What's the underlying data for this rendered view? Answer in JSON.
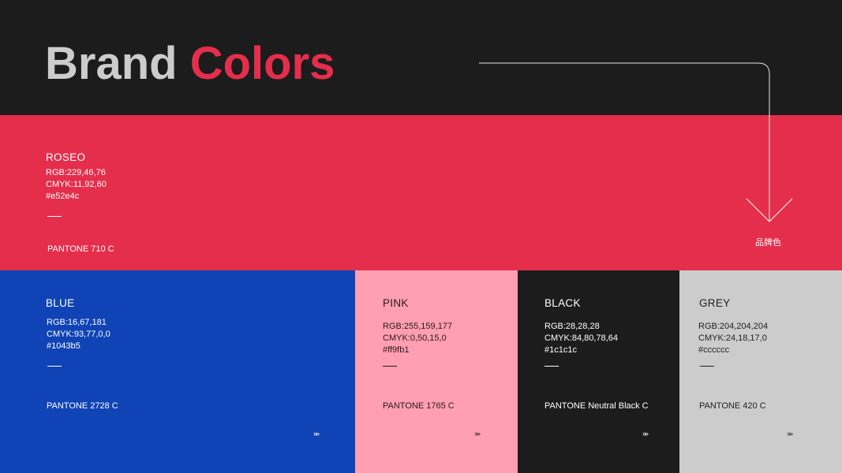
{
  "header": {
    "title_word1": "Brand",
    "title_word2": "Colors"
  },
  "primary": {
    "name": "ROSEO",
    "rgb": "RGB:229,46,76",
    "cmyk": "CMYK:11,92,60",
    "hex": "#e52e4c",
    "pantone": "PANTONE 710 C",
    "label": "品牌色",
    "bg": "#e52e4c",
    "text": "#ffffff"
  },
  "swatches": [
    {
      "name": "BLUE",
      "rgb": "RGB:16,67,181",
      "cmyk": "CMYK:93,77,0,0",
      "hex": "#1043b5",
      "pantone": "PANTONE 2728 C",
      "more": "»»",
      "bg": "#1043b5",
      "text": "#ffffff"
    },
    {
      "name": "PINK",
      "rgb": "RGB:255,159,177",
      "cmyk": "CMYK:0,50,15,0",
      "hex": "#ff9fb1",
      "pantone": "PANTONE 1765 C",
      "more": "»»",
      "bg": "#ff9fb1",
      "text": "#2a1a1d"
    },
    {
      "name": "BLACK",
      "rgb": "RGB:28,28,28",
      "cmyk": "CMYK:84,80,78,64",
      "hex": "#1c1c1c",
      "pantone": "PANTONE Neutral Black C",
      "more": "»»",
      "bg": "#1c1c1c",
      "text": "#ffffff"
    },
    {
      "name": "GREY",
      "rgb": "RGB:204,204,204",
      "cmyk": "CMYK:24,18,17,0",
      "hex": "#cccccc",
      "pantone": "PANTONE 420 C",
      "more": "»»",
      "bg": "#cccccc",
      "text": "#222222"
    }
  ]
}
